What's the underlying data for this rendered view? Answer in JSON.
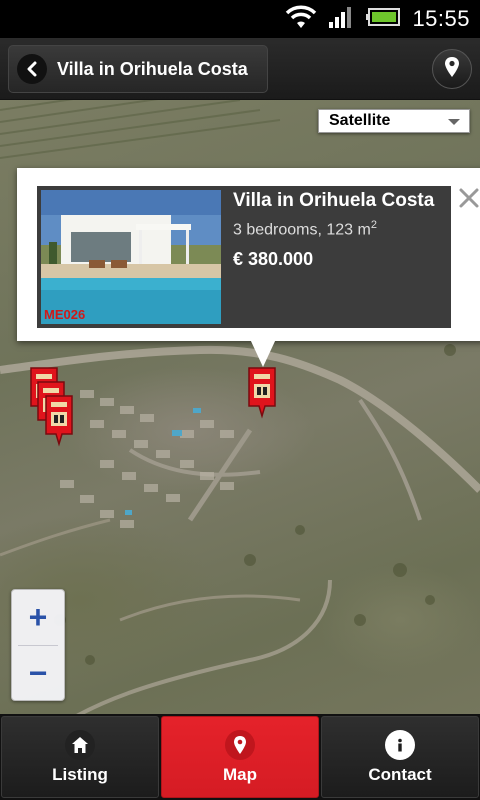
{
  "status_bar": {
    "time": "15:55",
    "icons": [
      "wifi-icon",
      "signal-icon",
      "battery-icon"
    ]
  },
  "action_bar": {
    "title": "Villa in Orihuela Costa",
    "back_icon": "chevron-left-icon",
    "location_icon": "map-pin-icon"
  },
  "map": {
    "type_selector": {
      "value": "Satellite"
    },
    "zoom": {
      "zoom_in": "+",
      "zoom_out": "−"
    },
    "info_window": {
      "title": "Villa in Orihuela Costa",
      "subtitle": "3 bedrooms, 123 m",
      "subtitle_sup": "2",
      "price": "€ 380.000",
      "reference": "ME026",
      "close_icon": "close-icon"
    },
    "markers": [
      {
        "name": "property-marker-main"
      },
      {
        "name": "property-marker-cluster-1"
      },
      {
        "name": "property-marker-cluster-2"
      },
      {
        "name": "property-marker-cluster-3"
      }
    ]
  },
  "bottom_nav": {
    "items": [
      {
        "label": "Listing",
        "icon": "home-icon",
        "active": false
      },
      {
        "label": "Map",
        "icon": "map-pin-icon",
        "active": true
      },
      {
        "label": "Contact",
        "icon": "info-icon",
        "active": false
      }
    ]
  },
  "colors": {
    "accent": "#e5222a",
    "marker": "#e0141c",
    "bar_bg": "#1b1b1b"
  }
}
